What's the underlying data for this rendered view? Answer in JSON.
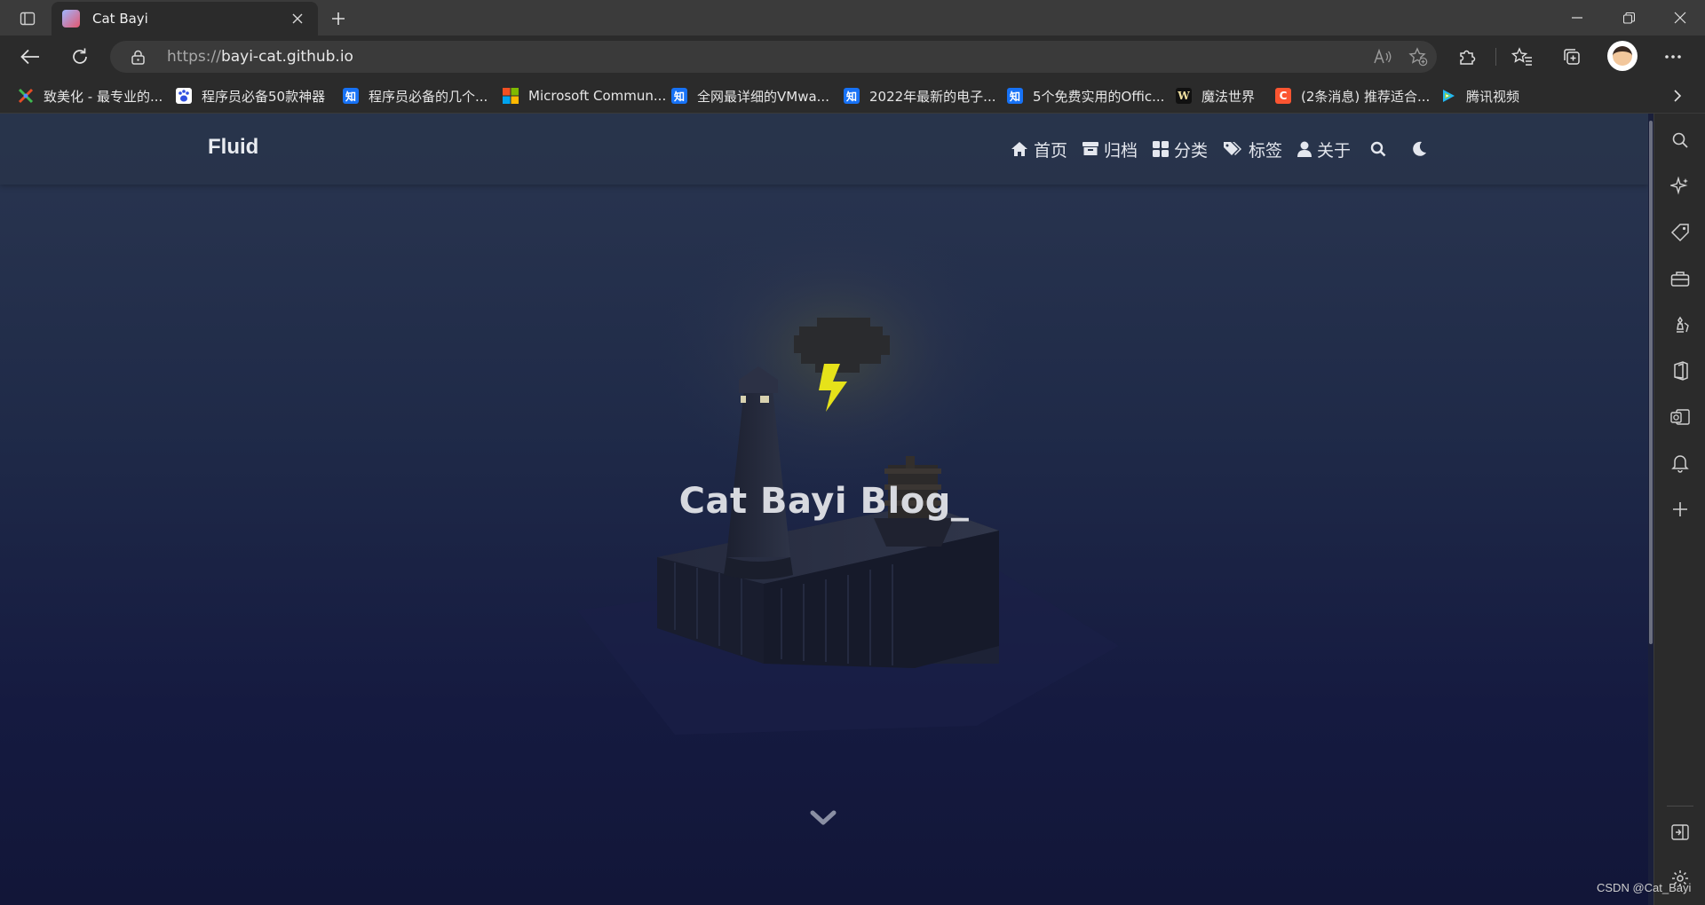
{
  "browser": {
    "tab": {
      "title": "Cat Bayi"
    },
    "address": {
      "scheme": "https://",
      "host": "bayi-cat.github.io"
    },
    "bookmarks": [
      {
        "label": "致美化 - 最专业的...",
        "icon": "colorful-x-icon",
        "color": "#2b2b2b"
      },
      {
        "label": "程序员必备50款神器",
        "icon": "baidu-paw-icon",
        "color": "#2f4fe0"
      },
      {
        "label": "程序员必备的几个...",
        "icon": "zhihu-icon",
        "color": "#1772f6"
      },
      {
        "label": "Microsoft Commun...",
        "icon": "microsoft-icon",
        "color": "#f25022"
      },
      {
        "label": "全网最详细的VMwa...",
        "icon": "zhihu-icon",
        "color": "#1772f6"
      },
      {
        "label": "2022年最新的电子...",
        "icon": "zhihu-icon",
        "color": "#1772f6"
      },
      {
        "label": "5个免费实用的Offic...",
        "icon": "zhihu-icon",
        "color": "#1772f6"
      },
      {
        "label": "魔法世界",
        "icon": "w-icon",
        "color": "#111111"
      },
      {
        "label": "(2条消息) 推荐适合...",
        "icon": "csdn-c-icon",
        "color": "#fc5531"
      },
      {
        "label": "腾讯视频",
        "icon": "tencent-video-icon",
        "color": "#21b7f3"
      }
    ],
    "zhihu_glyph": "知",
    "w_glyph": "W",
    "c_glyph": "C"
  },
  "site": {
    "brand": "Fluid",
    "nav": [
      {
        "label": "首页",
        "icon": "home-icon"
      },
      {
        "label": "归档",
        "icon": "archive-icon"
      },
      {
        "label": "分类",
        "icon": "categories-icon"
      },
      {
        "label": "标签",
        "icon": "tags-icon"
      },
      {
        "label": "关于",
        "icon": "user-icon"
      }
    ],
    "hero_title": "Cat Bayi Blog_",
    "colors": {
      "navbar": "#28344a",
      "bg_top": "#2a3650",
      "bg_bottom": "#121638",
      "lightning": "#e6e21a"
    }
  },
  "watermark": "CSDN @Cat_Bayi"
}
